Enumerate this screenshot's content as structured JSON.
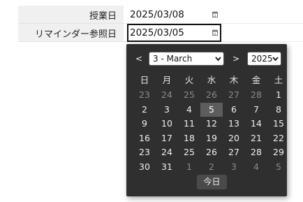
{
  "form": {
    "rows": [
      {
        "label": "授業日",
        "value": "2025/03/08",
        "icon": "calendar-icon"
      },
      {
        "label": "リマインダー参照日",
        "value": "2025/03/05",
        "icon": "calendar-icon"
      }
    ]
  },
  "datepicker": {
    "prev_label": "<",
    "next_label": ">",
    "month_selected": "3 - March",
    "year_selected": "2025",
    "weekdays": [
      "日",
      "月",
      "火",
      "水",
      "木",
      "金",
      "土"
    ],
    "weeks": [
      [
        {
          "d": "23",
          "m": true
        },
        {
          "d": "24",
          "m": true
        },
        {
          "d": "25",
          "m": true
        },
        {
          "d": "26",
          "m": true
        },
        {
          "d": "27",
          "m": true
        },
        {
          "d": "28",
          "m": true
        },
        {
          "d": "1",
          "m": false
        }
      ],
      [
        {
          "d": "2",
          "m": false
        },
        {
          "d": "3",
          "m": false
        },
        {
          "d": "4",
          "m": false
        },
        {
          "d": "5",
          "m": false,
          "sel": true
        },
        {
          "d": "6",
          "m": false
        },
        {
          "d": "7",
          "m": false
        },
        {
          "d": "8",
          "m": false
        }
      ],
      [
        {
          "d": "9",
          "m": false
        },
        {
          "d": "10",
          "m": false
        },
        {
          "d": "11",
          "m": false
        },
        {
          "d": "12",
          "m": false
        },
        {
          "d": "13",
          "m": false
        },
        {
          "d": "14",
          "m": false
        },
        {
          "d": "15",
          "m": false
        }
      ],
      [
        {
          "d": "16",
          "m": false
        },
        {
          "d": "17",
          "m": false
        },
        {
          "d": "18",
          "m": false
        },
        {
          "d": "19",
          "m": false
        },
        {
          "d": "20",
          "m": false
        },
        {
          "d": "21",
          "m": false
        },
        {
          "d": "22",
          "m": false
        }
      ],
      [
        {
          "d": "23",
          "m": false
        },
        {
          "d": "24",
          "m": false
        },
        {
          "d": "25",
          "m": false
        },
        {
          "d": "26",
          "m": false
        },
        {
          "d": "27",
          "m": false
        },
        {
          "d": "28",
          "m": false
        },
        {
          "d": "29",
          "m": false
        }
      ],
      [
        {
          "d": "30",
          "m": false
        },
        {
          "d": "31",
          "m": false
        },
        {
          "d": "1",
          "m": true
        },
        {
          "d": "2",
          "m": true
        },
        {
          "d": "3",
          "m": true
        },
        {
          "d": "4",
          "m": true
        },
        {
          "d": "5",
          "m": true
        }
      ]
    ],
    "today_label": "今日"
  },
  "colors": {
    "picker_bg": "#2f2f2f",
    "selected_day_bg": "#5d5d5d",
    "label_bg": "#f0f0f0"
  }
}
